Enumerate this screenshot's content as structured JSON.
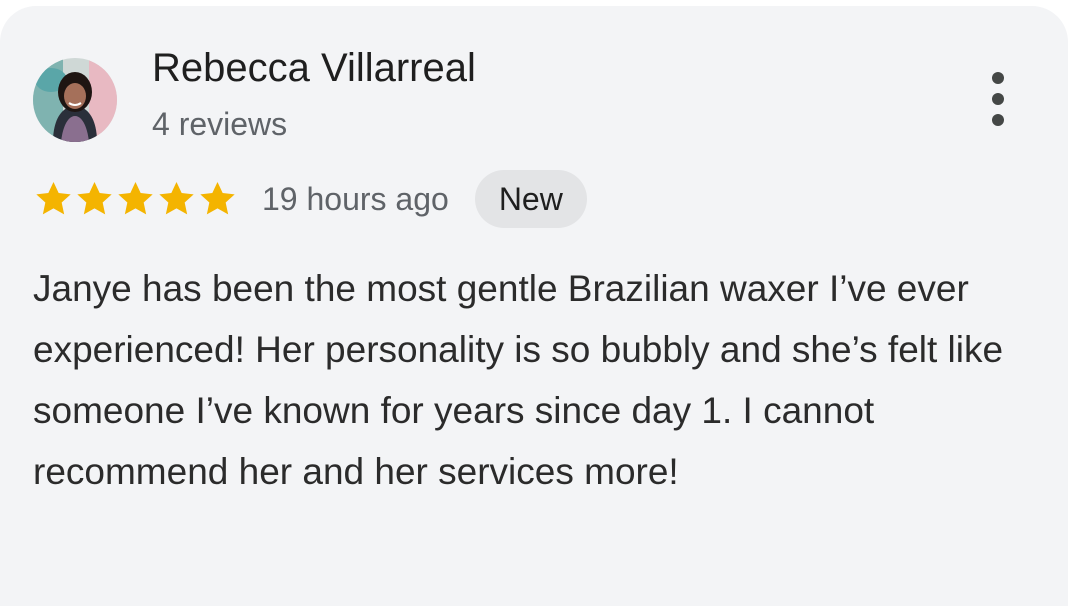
{
  "review": {
    "author": {
      "name": "Rebecca Villarreal",
      "meta": "4 reviews",
      "avatar": "user-avatar-photo"
    },
    "rating": {
      "stars": 5,
      "max": 5,
      "star_color": "#f4b400"
    },
    "time_ago": "19 hours ago",
    "badge": "New",
    "text": "Janye has been the most gentle Brazilian waxer I’ve ever experienced! Her personality is so bubbly and she’s felt like someone I’ve known for years since day 1. I cannot recommend her and her services more!",
    "menu_icon": "more-vert-icon"
  },
  "colors": {
    "card_background": "#f3f4f6",
    "badge_background": "#e3e4e6",
    "primary_text": "#1f1f1f",
    "secondary_text": "#5f6368"
  }
}
